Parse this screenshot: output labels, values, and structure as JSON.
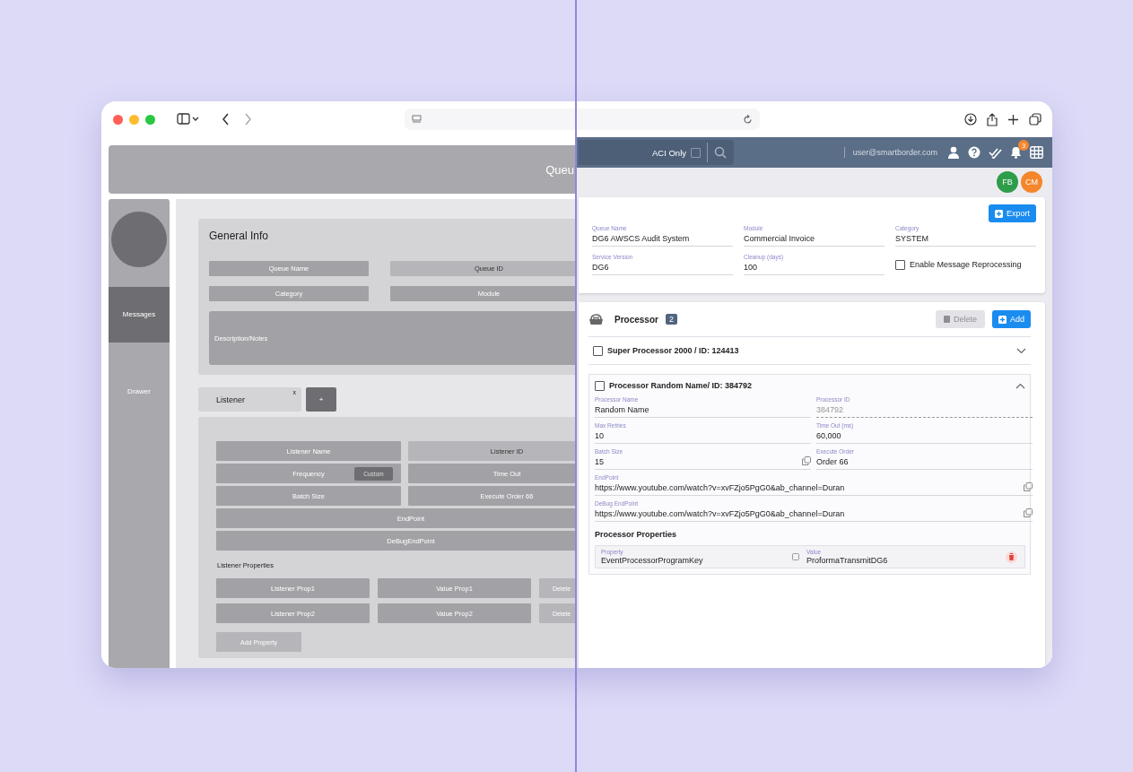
{
  "wireframe": {
    "header_title": "Queu",
    "sidebar": [
      {
        "label": "Messages",
        "selected": true
      },
      {
        "label": "Drawer",
        "selected": false
      }
    ],
    "general_info": {
      "title": "General Info",
      "fields": [
        {
          "label": "Queue Name",
          "kind": "input"
        },
        {
          "label": "Queue ID",
          "kind": "static"
        },
        {
          "label": "Category",
          "kind": "input"
        },
        {
          "label": "Module",
          "kind": "input"
        }
      ],
      "description": "Description/Notes"
    },
    "tabs": [
      {
        "label": "Listener",
        "close": "x"
      }
    ],
    "add_tab": "+",
    "listener_fields": [
      {
        "label": "Listener Name",
        "kind": "input",
        "wide": false
      },
      {
        "label": "Listener ID",
        "kind": "static",
        "wide": false
      },
      {
        "label": "Frequency",
        "kind": "input",
        "wide": false,
        "button": "Custom"
      },
      {
        "label": "Time Out",
        "kind": "input",
        "wide": false
      },
      {
        "label": "Batch Size",
        "kind": "input",
        "wide": false
      },
      {
        "label": "Execute Order 66",
        "kind": "input",
        "wide": false
      },
      {
        "label": "EndPoint",
        "kind": "input",
        "wide": true
      },
      {
        "label": "DeBugEndPoint",
        "kind": "input",
        "wide": true
      }
    ],
    "properties_title": "Listener Properties",
    "properties": [
      {
        "name": "Listener Prop1",
        "value": "Value Prop1",
        "delete": "Delete"
      },
      {
        "name": "Listener Prop2",
        "value": "Value Prop2",
        "delete": "Delete"
      }
    ],
    "add_property": "Add Property"
  },
  "app": {
    "aci": {
      "label": "ACI Only",
      "checked": false
    },
    "user": "user@smartborder.com",
    "notifications": "3",
    "avatars": [
      {
        "initials": "FB",
        "color": "#2e9d4a"
      },
      {
        "initials": "CM",
        "color": "#f5862c"
      }
    ],
    "export": "Export",
    "queue_fields": [
      {
        "label": "Queue Name",
        "value": "DG6 AWSCS Audit System"
      },
      {
        "label": "Module",
        "value": "Commercial Invoice"
      },
      {
        "label": "Category",
        "value": "SYSTEM"
      },
      {
        "label": "Service Version",
        "value": "DG6"
      },
      {
        "label": "Cleanup (days)",
        "value": "100"
      }
    ],
    "reprocessing": {
      "label": "Enable Message Reprocessing",
      "checked": false
    },
    "processor": {
      "title": "Processor",
      "count": "2",
      "delete": {
        "label": "Delete",
        "disabled": true
      },
      "add": "Add",
      "items": [
        {
          "title": "Super Processor 2000 / ID: 124413",
          "checked": false,
          "expanded": false
        },
        {
          "title": "Processor Random Name/ ID: 384792",
          "checked": false,
          "expanded": true,
          "fields": [
            {
              "label": "Processor Name",
              "value": "Random Name",
              "readonly": false,
              "copy": false,
              "wide": false
            },
            {
              "label": "Processor ID",
              "value": "384792",
              "readonly": true,
              "copy": false,
              "wide": false
            },
            {
              "label": "Max Retries",
              "value": "10",
              "readonly": false,
              "copy": false,
              "wide": false
            },
            {
              "label": "Time Out (ms)",
              "value": "60,000",
              "readonly": false,
              "copy": false,
              "wide": false
            },
            {
              "label": "Batch Size",
              "value": "15",
              "readonly": false,
              "copy": true,
              "wide": false
            },
            {
              "label": "Execute Order",
              "value": "Order 66",
              "readonly": false,
              "copy": false,
              "wide": false
            },
            {
              "label": "EndPoint",
              "value": "https://www.youtube.com/watch?v=xvFZjo5PgG0&ab_channel=Duran",
              "readonly": false,
              "copy": true,
              "wide": true
            },
            {
              "label": "DeBug EndPoint",
              "value": "https://www.youtube.com/watch?v=xvFZjo5PgG0&ab_channel=Duran",
              "readonly": false,
              "copy": true,
              "wide": true
            }
          ]
        }
      ],
      "properties_title": "Processor Properties",
      "properties": [
        {
          "property_label": "Property",
          "property": "EventProcessorProgramKey",
          "value_label": "Value",
          "value": "ProformaTransmitDG6"
        }
      ]
    }
  }
}
